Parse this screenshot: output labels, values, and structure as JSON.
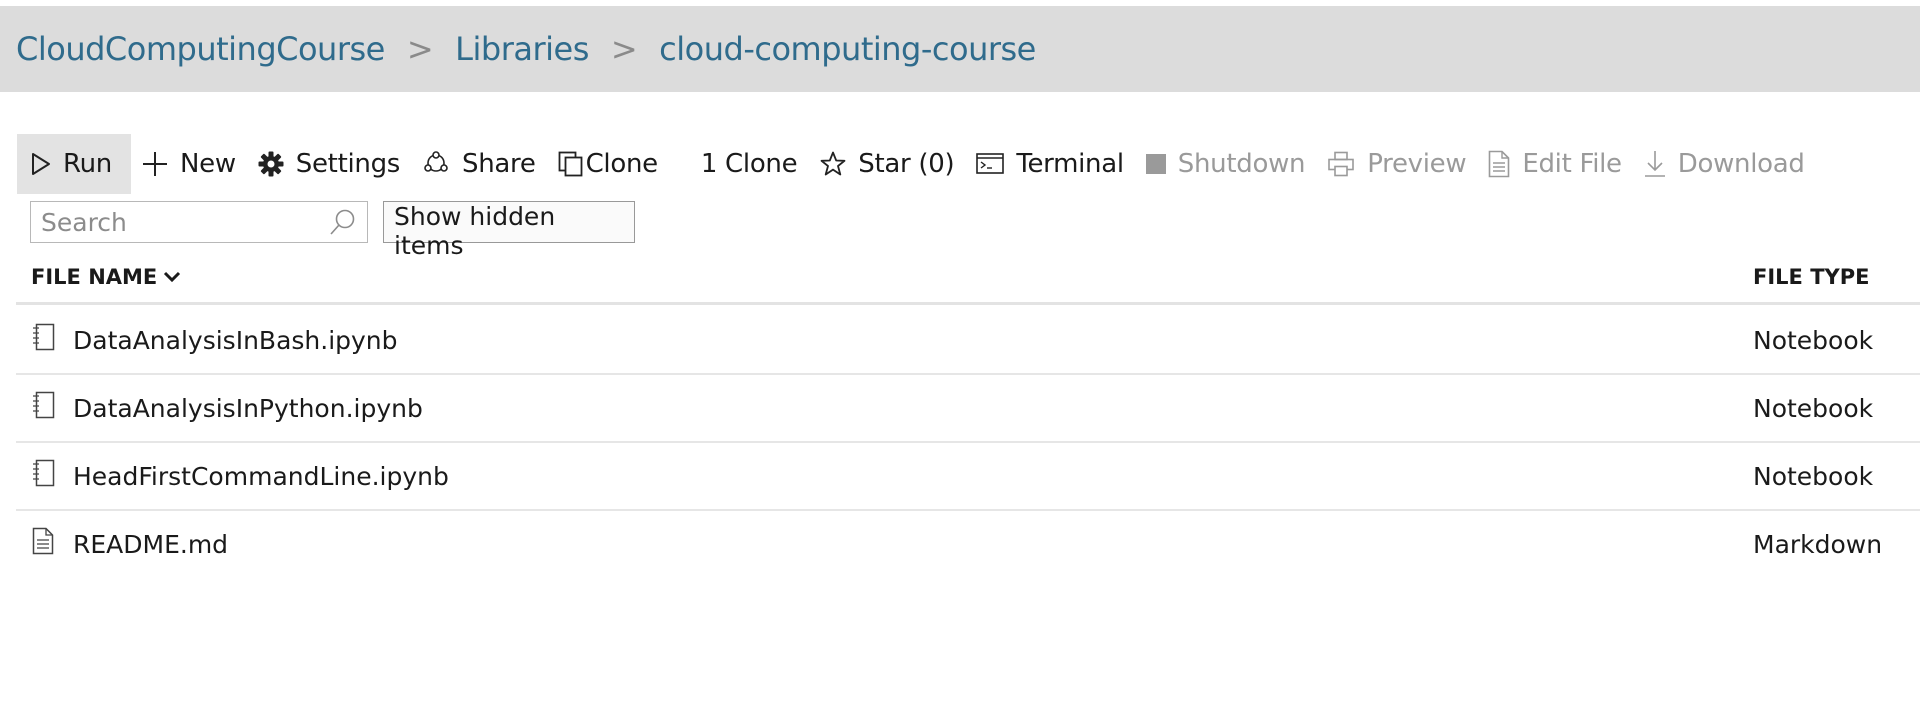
{
  "breadcrumb": {
    "items": [
      "CloudComputingCourse",
      "Libraries",
      "cloud-computing-course"
    ],
    "separator": ">"
  },
  "toolbar": {
    "run": "Run",
    "new": "New",
    "settings": "Settings",
    "share": "Share",
    "clone": "Clone",
    "clone_count": "1 Clone",
    "star": "Star (0)",
    "terminal": "Terminal",
    "shutdown": "Shutdown",
    "preview": "Preview",
    "edit_file": "Edit File",
    "download": "Download"
  },
  "search": {
    "placeholder": "Search",
    "value": ""
  },
  "show_hidden_label": "Show hidden items",
  "table": {
    "columns": [
      "FILE NAME",
      "FILE TYPE"
    ],
    "rows": [
      {
        "name": "DataAnalysisInBash.ipynb",
        "type": "Notebook",
        "icon": "notebook-icon"
      },
      {
        "name": "DataAnalysisInPython.ipynb",
        "type": "Notebook",
        "icon": "notebook-icon"
      },
      {
        "name": "HeadFirstCommandLine.ipynb",
        "type": "Notebook",
        "icon": "notebook-icon"
      },
      {
        "name": "README.md",
        "type": "Markdown",
        "icon": "document-icon"
      }
    ]
  },
  "colors": {
    "link": "#2f6b8c",
    "header_bg": "#dcdcdc",
    "disabled": "#9a9a9a"
  }
}
